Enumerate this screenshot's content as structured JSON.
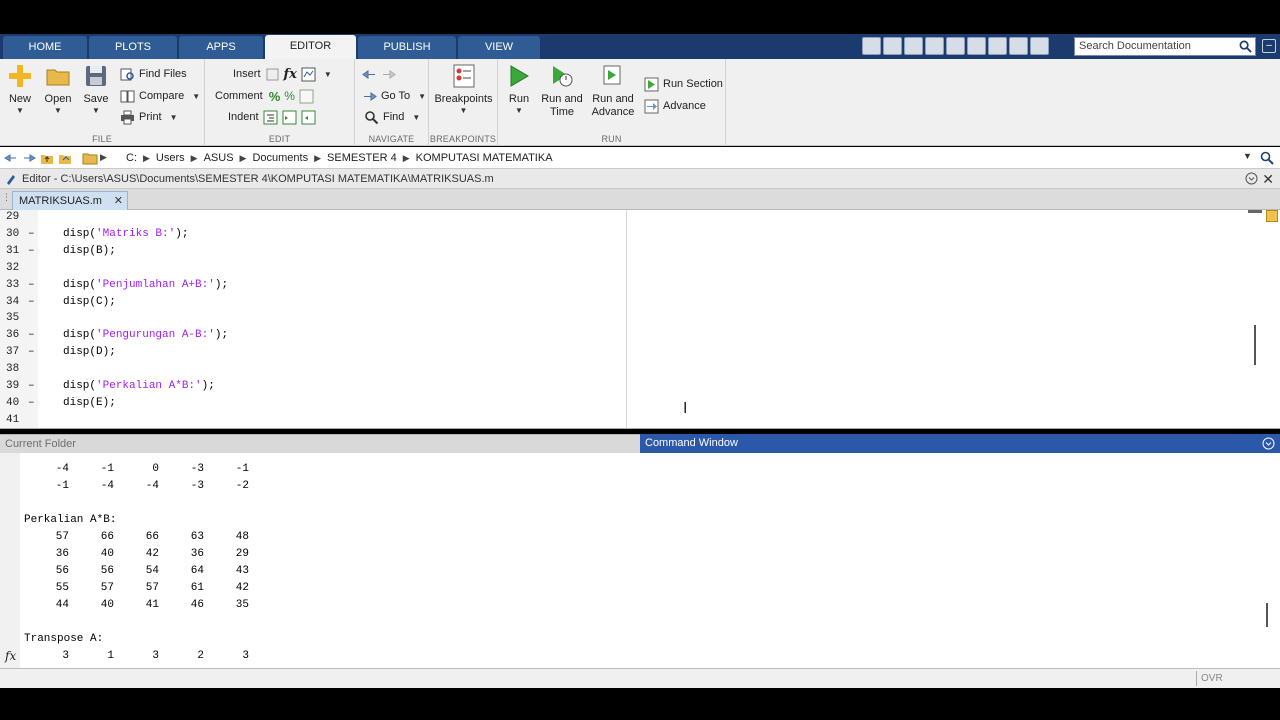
{
  "tabs": [
    {
      "label": "HOME"
    },
    {
      "label": "PLOTS"
    },
    {
      "label": "APPS"
    },
    {
      "label": "EDITOR"
    },
    {
      "label": "PUBLISH"
    },
    {
      "label": "VIEW"
    }
  ],
  "active_tab": "EDITOR",
  "search": {
    "placeholder": "Search Documentation"
  },
  "ribbon": {
    "file": {
      "title": "FILE",
      "new": "New",
      "open": "Open",
      "save": "Save",
      "find_files": "Find Files",
      "compare": "Compare",
      "print": "Print"
    },
    "edit": {
      "title": "EDIT",
      "insert": "Insert",
      "comment": "Comment",
      "indent": "Indent",
      "fx": "fx"
    },
    "navigate": {
      "title": "NAVIGATE",
      "go_to": "Go To",
      "find": "Find"
    },
    "breakpoints": {
      "title": "BREAKPOINTS",
      "breakpoints": "Breakpoints"
    },
    "run": {
      "title": "RUN",
      "run": "Run",
      "run_and_time_1": "Run and",
      "run_and_time_2": "Time",
      "run_and_advance_1": "Run and",
      "run_and_advance_2": "Advance",
      "run_section": "Run Section",
      "advance": "Advance"
    }
  },
  "address": {
    "crumbs": [
      "C:",
      "Users",
      "ASUS",
      "Documents",
      "SEMESTER 4",
      "KOMPUTASI MATEMATIKA"
    ]
  },
  "editor": {
    "title": "Editor - C:\\Users\\ASUS\\Documents\\SEMESTER 4\\KOMPUTASI MATEMATIKA\\MATRIKSUAS.m",
    "doc_tab": "MATRIKSUAS.m",
    "lines": [
      {
        "num": "29",
        "dash": "",
        "pre": "",
        "str": "",
        "post": ""
      },
      {
        "num": "30",
        "dash": "–",
        "pre": "disp(",
        "str": "'Matriks B:'",
        "post": ");"
      },
      {
        "num": "31",
        "dash": "–",
        "pre": "disp(B);",
        "str": "",
        "post": ""
      },
      {
        "num": "32",
        "dash": "",
        "pre": "",
        "str": "",
        "post": ""
      },
      {
        "num": "33",
        "dash": "–",
        "pre": "disp(",
        "str": "'Penjumlahan A+B:'",
        "post": ");"
      },
      {
        "num": "34",
        "dash": "–",
        "pre": "disp(C);",
        "str": "",
        "post": ""
      },
      {
        "num": "35",
        "dash": "",
        "pre": "",
        "str": "",
        "post": ""
      },
      {
        "num": "36",
        "dash": "–",
        "pre": "disp(",
        "str": "'Pengurungan A-B:'",
        "post": ");"
      },
      {
        "num": "37",
        "dash": "–",
        "pre": "disp(D);",
        "str": "",
        "post": ""
      },
      {
        "num": "38",
        "dash": "",
        "pre": "",
        "str": "",
        "post": ""
      },
      {
        "num": "39",
        "dash": "–",
        "pre": "disp(",
        "str": "'Perkalian A*B:'",
        "post": ");"
      },
      {
        "num": "40",
        "dash": "–",
        "pre": "disp(E);",
        "str": "",
        "post": ""
      },
      {
        "num": "41",
        "dash": "",
        "pre": "",
        "str": "",
        "post": ""
      }
    ]
  },
  "panels": {
    "current_folder": "Current Folder",
    "command_window": "Command Window"
  },
  "command_window": {
    "rows_top": [
      [
        "-4",
        "-1",
        "0",
        "-3",
        "-1"
      ],
      [
        "-1",
        "-4",
        "-4",
        "-3",
        "-2"
      ]
    ],
    "heading_mult": "Perkalian A*B:",
    "rows_mult": [
      [
        "57",
        "66",
        "66",
        "63",
        "48"
      ],
      [
        "36",
        "40",
        "42",
        "36",
        "29"
      ],
      [
        "56",
        "56",
        "54",
        "64",
        "43"
      ],
      [
        "55",
        "57",
        "57",
        "61",
        "42"
      ],
      [
        "44",
        "40",
        "41",
        "46",
        "35"
      ]
    ],
    "heading_trans": "Transpose A:",
    "rows_trans": [
      [
        "3",
        "1",
        "3",
        "2",
        "3"
      ]
    ],
    "prompt_icon": "fx"
  },
  "status": {
    "mode": "OVR"
  }
}
